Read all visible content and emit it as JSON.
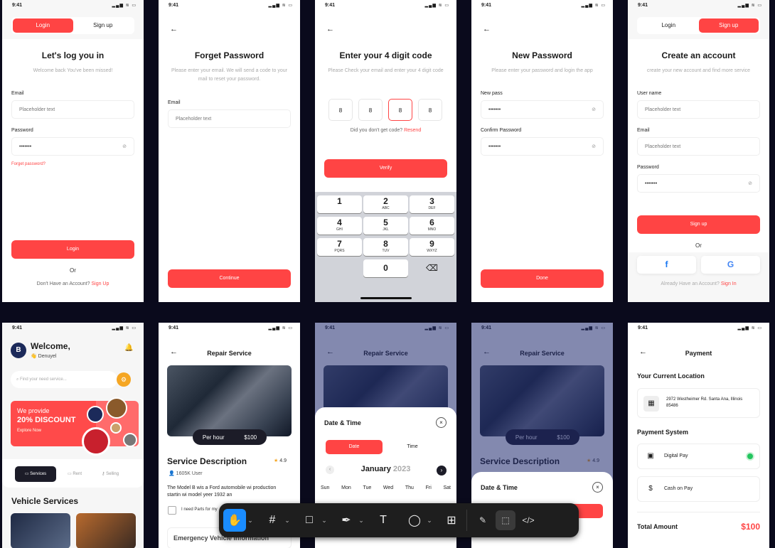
{
  "status_time": "9:41",
  "status_icons": "▂▄▆ ≋ ▭",
  "eye_icon": "⊘",
  "login": {
    "tab_login": "Login",
    "tab_signup": "Sign up",
    "title": "Let's log you in",
    "subtitle": "Welcome back You've been missed!",
    "email_label": "Email",
    "email_placeholder": "Placeholder text",
    "password_label": "Password",
    "password_value": "•••••••",
    "forget": "Forget password?",
    "button": "Login",
    "or": "Or",
    "footer": "Don't Have an Account?",
    "footer_link": "Sign Up"
  },
  "forget": {
    "title": "Forget Password",
    "subtitle": "Please enter your email. We will send a code to your mail to reset your password.",
    "email_label": "Email",
    "email_placeholder": "Placeholder text",
    "button": "Continue"
  },
  "code": {
    "title": "Enter your 4 digit code",
    "subtitle": "Please Check your email and enter your 4 digit code",
    "digits": [
      "8",
      "8",
      "8",
      "8"
    ],
    "resend_q": "Did you don't get code?",
    "resend": "Resend",
    "button": "Verify",
    "keys": [
      {
        "n": "1",
        "l": ""
      },
      {
        "n": "2",
        "l": "ABC"
      },
      {
        "n": "3",
        "l": "DEF"
      },
      {
        "n": "4",
        "l": "GHI"
      },
      {
        "n": "5",
        "l": "JKL"
      },
      {
        "n": "6",
        "l": "MNO"
      },
      {
        "n": "7",
        "l": "PQRS"
      },
      {
        "n": "8",
        "l": "TUV"
      },
      {
        "n": "9",
        "l": "WXYZ"
      },
      {
        "n": "0",
        "l": ""
      },
      {
        "n": "⌫",
        "l": ""
      }
    ]
  },
  "newpass": {
    "title": "New Password",
    "subtitle": "Please enter your password and login the app",
    "new_label": "New pass",
    "new_value": "•••••••",
    "confirm_label": "Confirm Password",
    "confirm_value": "•••••••",
    "button": "Done"
  },
  "signup": {
    "tab_login": "Login",
    "tab_signup": "Sign up",
    "title": "Create an account",
    "subtitle": "create your new account and find more service",
    "user_label": "User name",
    "user_placeholder": "Placeholder text",
    "email_label": "Email",
    "email_placeholder": "Placeholder text",
    "password_label": "Password",
    "password_value": "•••••••",
    "button": "Sign up",
    "or": "Or",
    "facebook": "f",
    "google": "G",
    "footer": "Already Have an Account?",
    "footer_link": "Sign In"
  },
  "home": {
    "welcome": "Welcome,",
    "user": "👋 Denuyel",
    "search_placeholder": "Find your need service...",
    "banner_line1": "We provide",
    "banner_line2": "20% DISCOUNT",
    "banner_cta": "Explore Now",
    "tabs": [
      "Services",
      "Rent",
      "Selling"
    ],
    "section": "Vehicle Services"
  },
  "repair": {
    "header": "Repair Service",
    "per_hour": "Per hour",
    "price": "$100",
    "desc_title": "Service Description",
    "rating": "4.9",
    "users": "1605K User",
    "desc": "The Model B wis a Ford automobile wi production startin wi model yeer 1932 an",
    "checkbox": "I need Parts for my",
    "emergency": "Emergency Vehicle Information"
  },
  "datetime": {
    "title": "Date & Time",
    "tab_date": "Date",
    "tab_time": "Time",
    "month": "January",
    "year": "2023",
    "days": [
      "Sun",
      "Mon",
      "Tue",
      "Wed",
      "Thu",
      "Fri",
      "Sat"
    ]
  },
  "datetime2": {
    "title": "Date & Time"
  },
  "payment": {
    "header": "Payment",
    "loc_title": "Your Current Location",
    "address": "2972 Westheimer Rd. Santa Ana, Illinois 85486",
    "system_title": "Payment System",
    "digital": "Digital Pay",
    "cash": "Cash on Pay",
    "total_label": "Total Amount",
    "total": "$100"
  },
  "toolbar": {
    "hand": "✋",
    "frame": "#",
    "rect": "□",
    "pen": "✒",
    "text": "T",
    "comment": "◯",
    "components": "⊞",
    "draw": "✎",
    "dev": "⬚",
    "code": "</>",
    "chev": "⌄"
  }
}
